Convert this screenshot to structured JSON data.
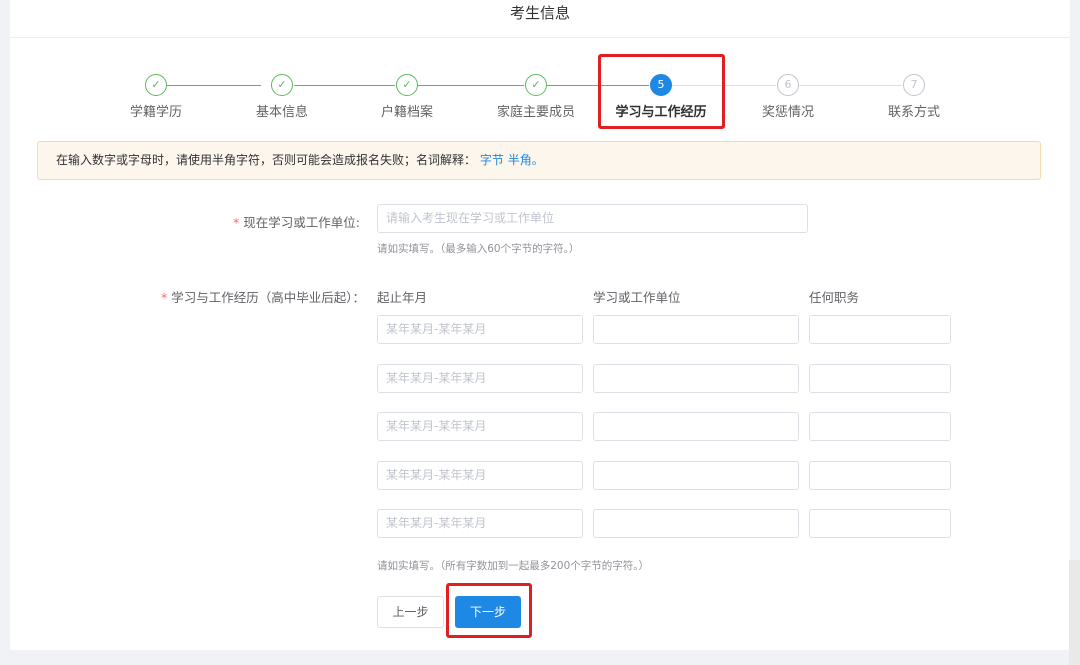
{
  "header": {
    "title": "考生信息"
  },
  "steps": [
    {
      "label": "学籍学历",
      "status": "done",
      "icon": "check-icon"
    },
    {
      "label": "基本信息",
      "status": "done",
      "icon": "check-icon"
    },
    {
      "label": "户籍档案",
      "status": "done",
      "icon": "check-icon"
    },
    {
      "label": "家庭主要成员",
      "status": "done",
      "icon": "check-icon"
    },
    {
      "label": "学习与工作经历",
      "status": "active",
      "number": "5"
    },
    {
      "label": "奖惩情况",
      "status": "todo",
      "number": "6"
    },
    {
      "label": "联系方式",
      "status": "todo",
      "number": "7"
    }
  ],
  "alert": {
    "text": "在输入数字或字母时，请使用半角字符，否则可能会造成报名失败；名词解释：",
    "link1": "字节",
    "link2": "半角。"
  },
  "form": {
    "current_unit": {
      "required_mark": "*",
      "label": "现在学习或工作单位:",
      "placeholder": "请输入考生现在学习或工作单位",
      "hint": "请如实填写。（最多输入60个字节的字符。）"
    },
    "history": {
      "required_mark": "*",
      "label": "学习与工作经历（高中毕业后起）：",
      "columns": [
        "起止年月",
        "学习或工作单位",
        "任何职务"
      ],
      "rows": [
        {
          "period_placeholder": "某年某月-某年某月",
          "unit": "",
          "position": ""
        },
        {
          "period_placeholder": "某年某月-某年某月",
          "unit": "",
          "position": ""
        },
        {
          "period_placeholder": "某年某月-某年某月",
          "unit": "",
          "position": ""
        },
        {
          "period_placeholder": "某年某月-某年某月",
          "unit": "",
          "position": ""
        },
        {
          "period_placeholder": "某年某月-某年某月",
          "unit": "",
          "position": ""
        }
      ],
      "hint": "请如实填写。（所有字数加到一起最多200个字节的字符。）"
    }
  },
  "buttons": {
    "prev": "上一步",
    "next": "下一步"
  },
  "colors": {
    "primary": "#1e88e5",
    "success": "#5cb85c",
    "highlight": "#e02020"
  }
}
